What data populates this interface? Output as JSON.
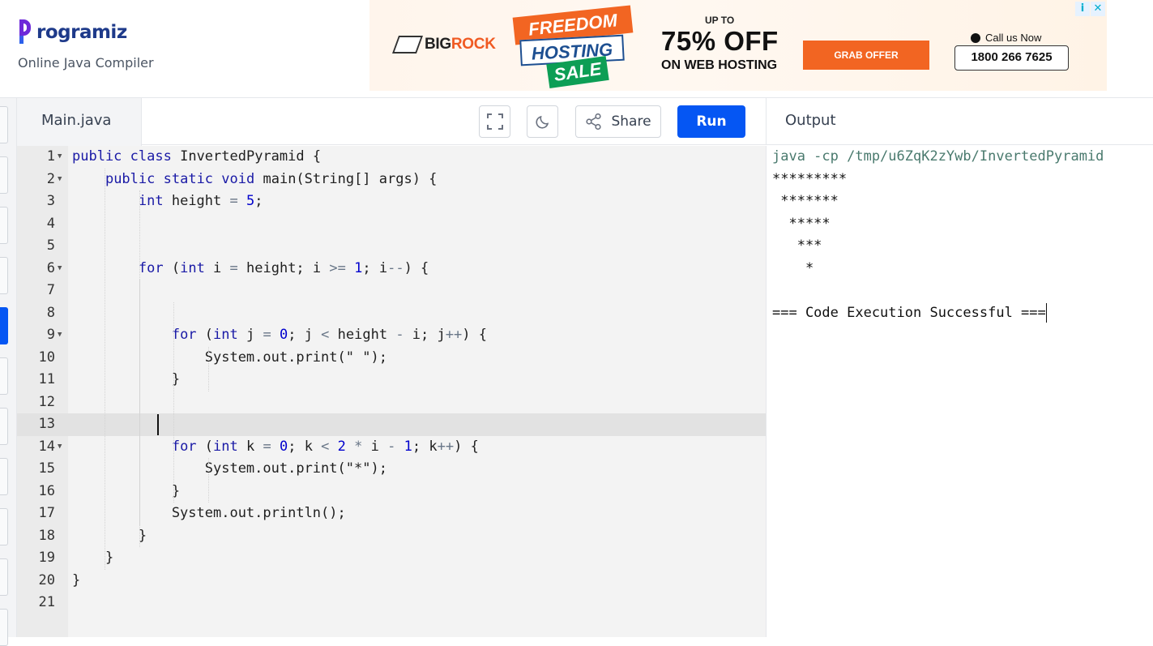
{
  "header": {
    "logo_text": "rogramiz",
    "subtitle": "Online Java Compiler"
  },
  "ad": {
    "brand_part1": "BIG",
    "brand_part2": "ROCK",
    "badge_line1": "FREEDOM",
    "badge_line2": "HOSTING",
    "badge_line3": "SALE",
    "up_to": "UP TO",
    "discount": "75% OFF",
    "discount_sub": "ON WEB HOSTING",
    "cta": "GRAB OFFER",
    "call_label": "Call us Now",
    "phone": "1800 266 7625",
    "info_icon": "i",
    "close_icon": "✕"
  },
  "toolbar": {
    "file_tab": "Main.java",
    "fullscreen_icon": "fullscreen-icon",
    "theme_icon": "moon-icon",
    "share_label": "Share",
    "run_label": "Run"
  },
  "editor": {
    "active_line": 13,
    "lines": [
      {
        "n": "1",
        "fold": true
      },
      {
        "n": "2",
        "fold": true
      },
      {
        "n": "3",
        "fold": false
      },
      {
        "n": "4",
        "fold": false
      },
      {
        "n": "5",
        "fold": false
      },
      {
        "n": "6",
        "fold": true
      },
      {
        "n": "7",
        "fold": false
      },
      {
        "n": "8",
        "fold": false
      },
      {
        "n": "9",
        "fold": true
      },
      {
        "n": "10",
        "fold": false
      },
      {
        "n": "11",
        "fold": false
      },
      {
        "n": "12",
        "fold": false
      },
      {
        "n": "13",
        "fold": false
      },
      {
        "n": "14",
        "fold": true
      },
      {
        "n": "15",
        "fold": false
      },
      {
        "n": "16",
        "fold": false
      },
      {
        "n": "17",
        "fold": false
      },
      {
        "n": "18",
        "fold": false
      },
      {
        "n": "19",
        "fold": false
      },
      {
        "n": "20",
        "fold": false
      },
      {
        "n": "21",
        "fold": false
      }
    ],
    "code": [
      "public class InvertedPyramid {",
      "    public static void main(String[] args) {",
      "        int height = 5;",
      "",
      "",
      "        for (int i = height; i >= 1; i--) {",
      "",
      "",
      "            for (int j = 0; j < height - i; j++) {",
      "                System.out.print(\" \");",
      "            }",
      "",
      "",
      "            for (int k = 0; k < 2 * i - 1; k++) {",
      "                System.out.print(\"*\");",
      "            }",
      "            System.out.println();",
      "        }",
      "    }",
      "}",
      ""
    ]
  },
  "output": {
    "title": "Output",
    "command": "java -cp /tmp/u6ZqK2zYwb/InvertedPyramid",
    "lines": [
      "*********",
      " *******",
      "  *****",
      "   ***",
      "    *",
      "",
      "=== Code Execution Successful ==="
    ]
  },
  "colors": {
    "run_button": "#0556f3",
    "keyword": "#1a1aa6",
    "output_command": "#4a7a6e",
    "active_line": "#e2e2e2"
  }
}
